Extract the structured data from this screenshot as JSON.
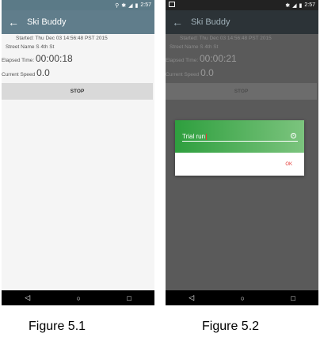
{
  "figure1": {
    "status_time": "2:57",
    "app_title": "Ski Buddy",
    "started": "Started: Thu Dec 03 14:56:48 PST 2015",
    "street": "Street Name S 4th St",
    "elapsed_label": "Elapsed Time:",
    "elapsed_value": "00:00:18",
    "speed_label": "Current Speed",
    "speed_value": "0.0",
    "stop_label": "STOP"
  },
  "figure2": {
    "status_time": "2:57",
    "app_title": "Ski Buddy",
    "started": "Started: Thu Dec 03 14:56:48 PST 2015",
    "street": "Street Name S 4th St",
    "elapsed_label": "Elapsed Time:",
    "elapsed_value": "00:00:21",
    "speed_label": "Current Speed",
    "speed_value": "0.0",
    "stop_label": "STOP",
    "dialog": {
      "input_value": "Trial run",
      "ok_label": "OK"
    }
  },
  "captions": [
    "Figure 5.1",
    "Figure 5.2"
  ]
}
